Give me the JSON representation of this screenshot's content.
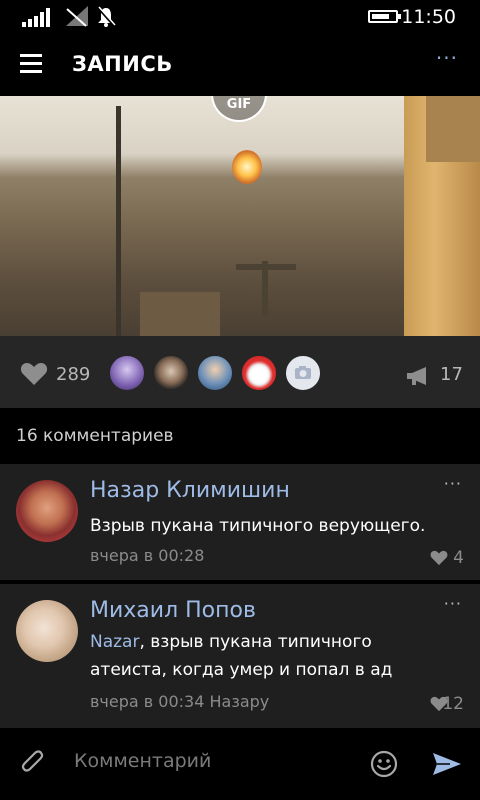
{
  "status": {
    "time": "11:50"
  },
  "header": {
    "title": "ЗАПИСЬ",
    "more": "···"
  },
  "media": {
    "badge": "GIF"
  },
  "actions": {
    "likes": "289",
    "reposts": "17",
    "avatars": 5
  },
  "comments_header": "16 комментариев",
  "comments": [
    {
      "name": "Назар Климишин",
      "text": "Взрыв пукана типичного верующего.",
      "time": "вчера в 00:28",
      "likes": "4",
      "more": "···"
    },
    {
      "name": "Михаил Попов",
      "mention": "Nazar",
      "text_rest": ", взрыв пукана типичного атеиста, когда умер и попал в ад",
      "time": "вчера в 00:34 Назару",
      "likes": "12",
      "more": "···"
    }
  ],
  "composer": {
    "placeholder": "Комментарий"
  },
  "colors": {
    "accent": "#9ebbe6",
    "panel": "#262626",
    "comment_bg": "#1f1f1f"
  }
}
